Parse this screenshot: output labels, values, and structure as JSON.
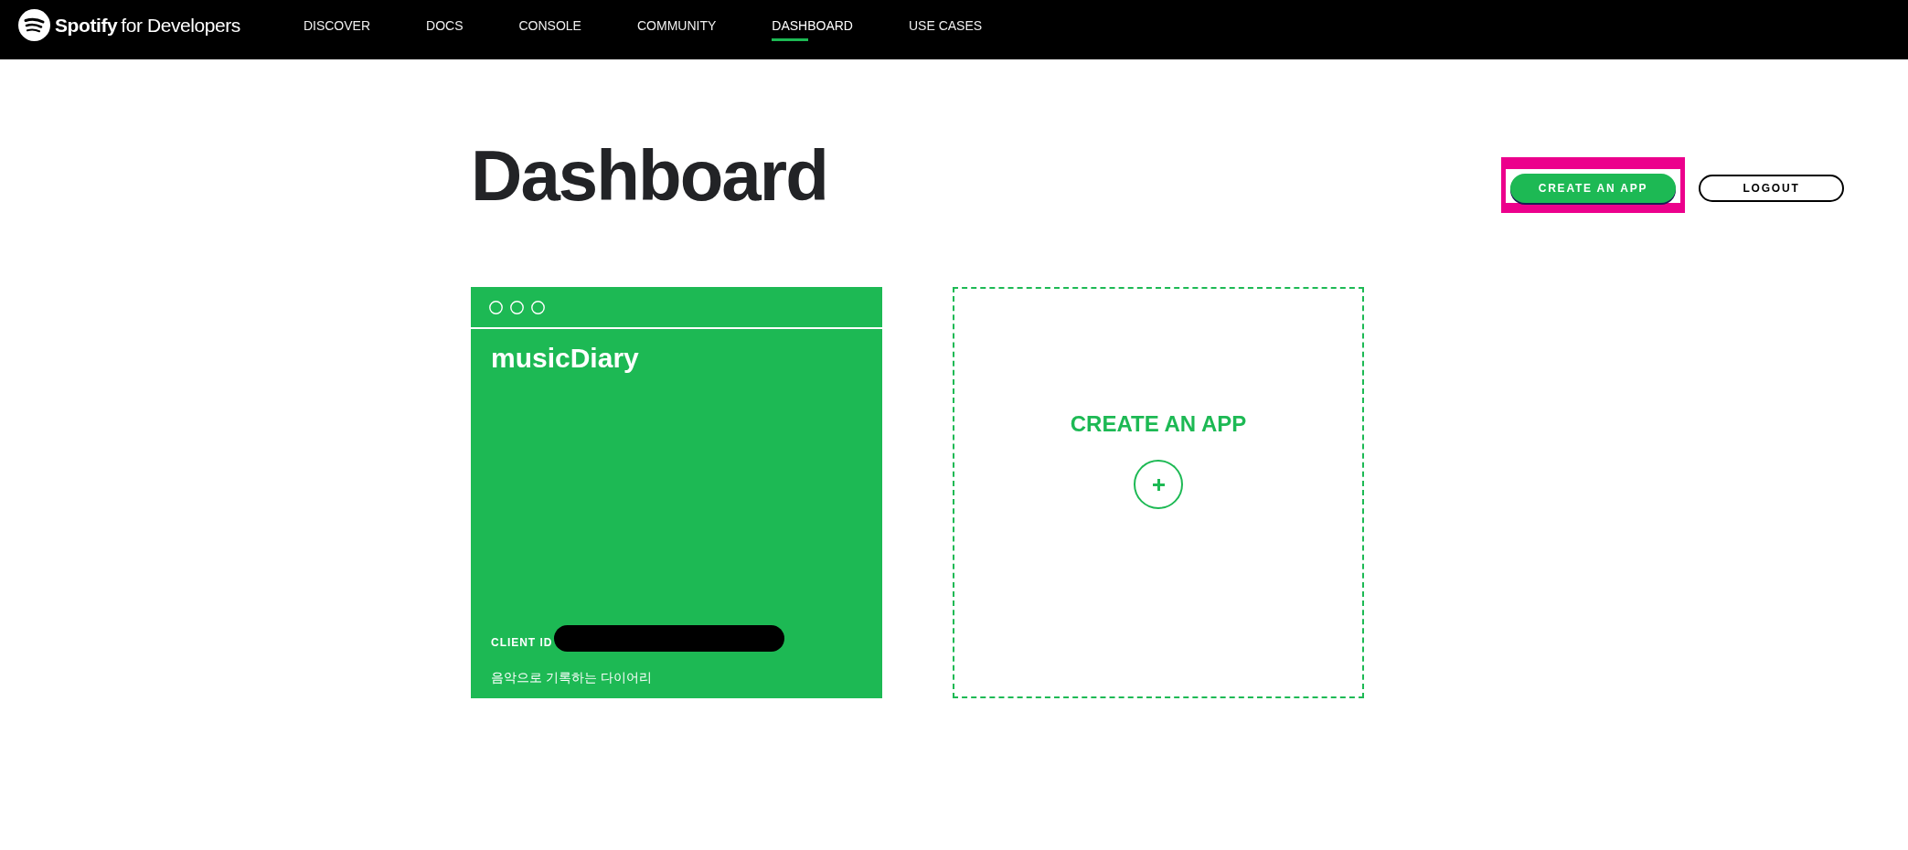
{
  "nav": {
    "brand": {
      "name": "Spotify",
      "suffix": "for Developers"
    },
    "items": [
      {
        "label": "DISCOVER",
        "selected": false
      },
      {
        "label": "DOCS",
        "selected": false
      },
      {
        "label": "CONSOLE",
        "selected": false
      },
      {
        "label": "COMMUNITY",
        "selected": false
      },
      {
        "label": "DASHBOARD",
        "selected": true
      },
      {
        "label": "USE CASES",
        "selected": false
      }
    ]
  },
  "header": {
    "title": "Dashboard",
    "buttons": [
      {
        "label": "CREATE AN APP",
        "kind": "primary",
        "highlighted": true
      },
      {
        "label": "LOGOUT",
        "kind": "outline",
        "highlighted": false
      }
    ]
  },
  "apps": [
    {
      "name": "musicDiary",
      "client_id_label": "CLIENT ID",
      "description": "음악으로 기록하는 다이어리"
    }
  ],
  "create_card": {
    "label": "CREATE AN APP"
  }
}
